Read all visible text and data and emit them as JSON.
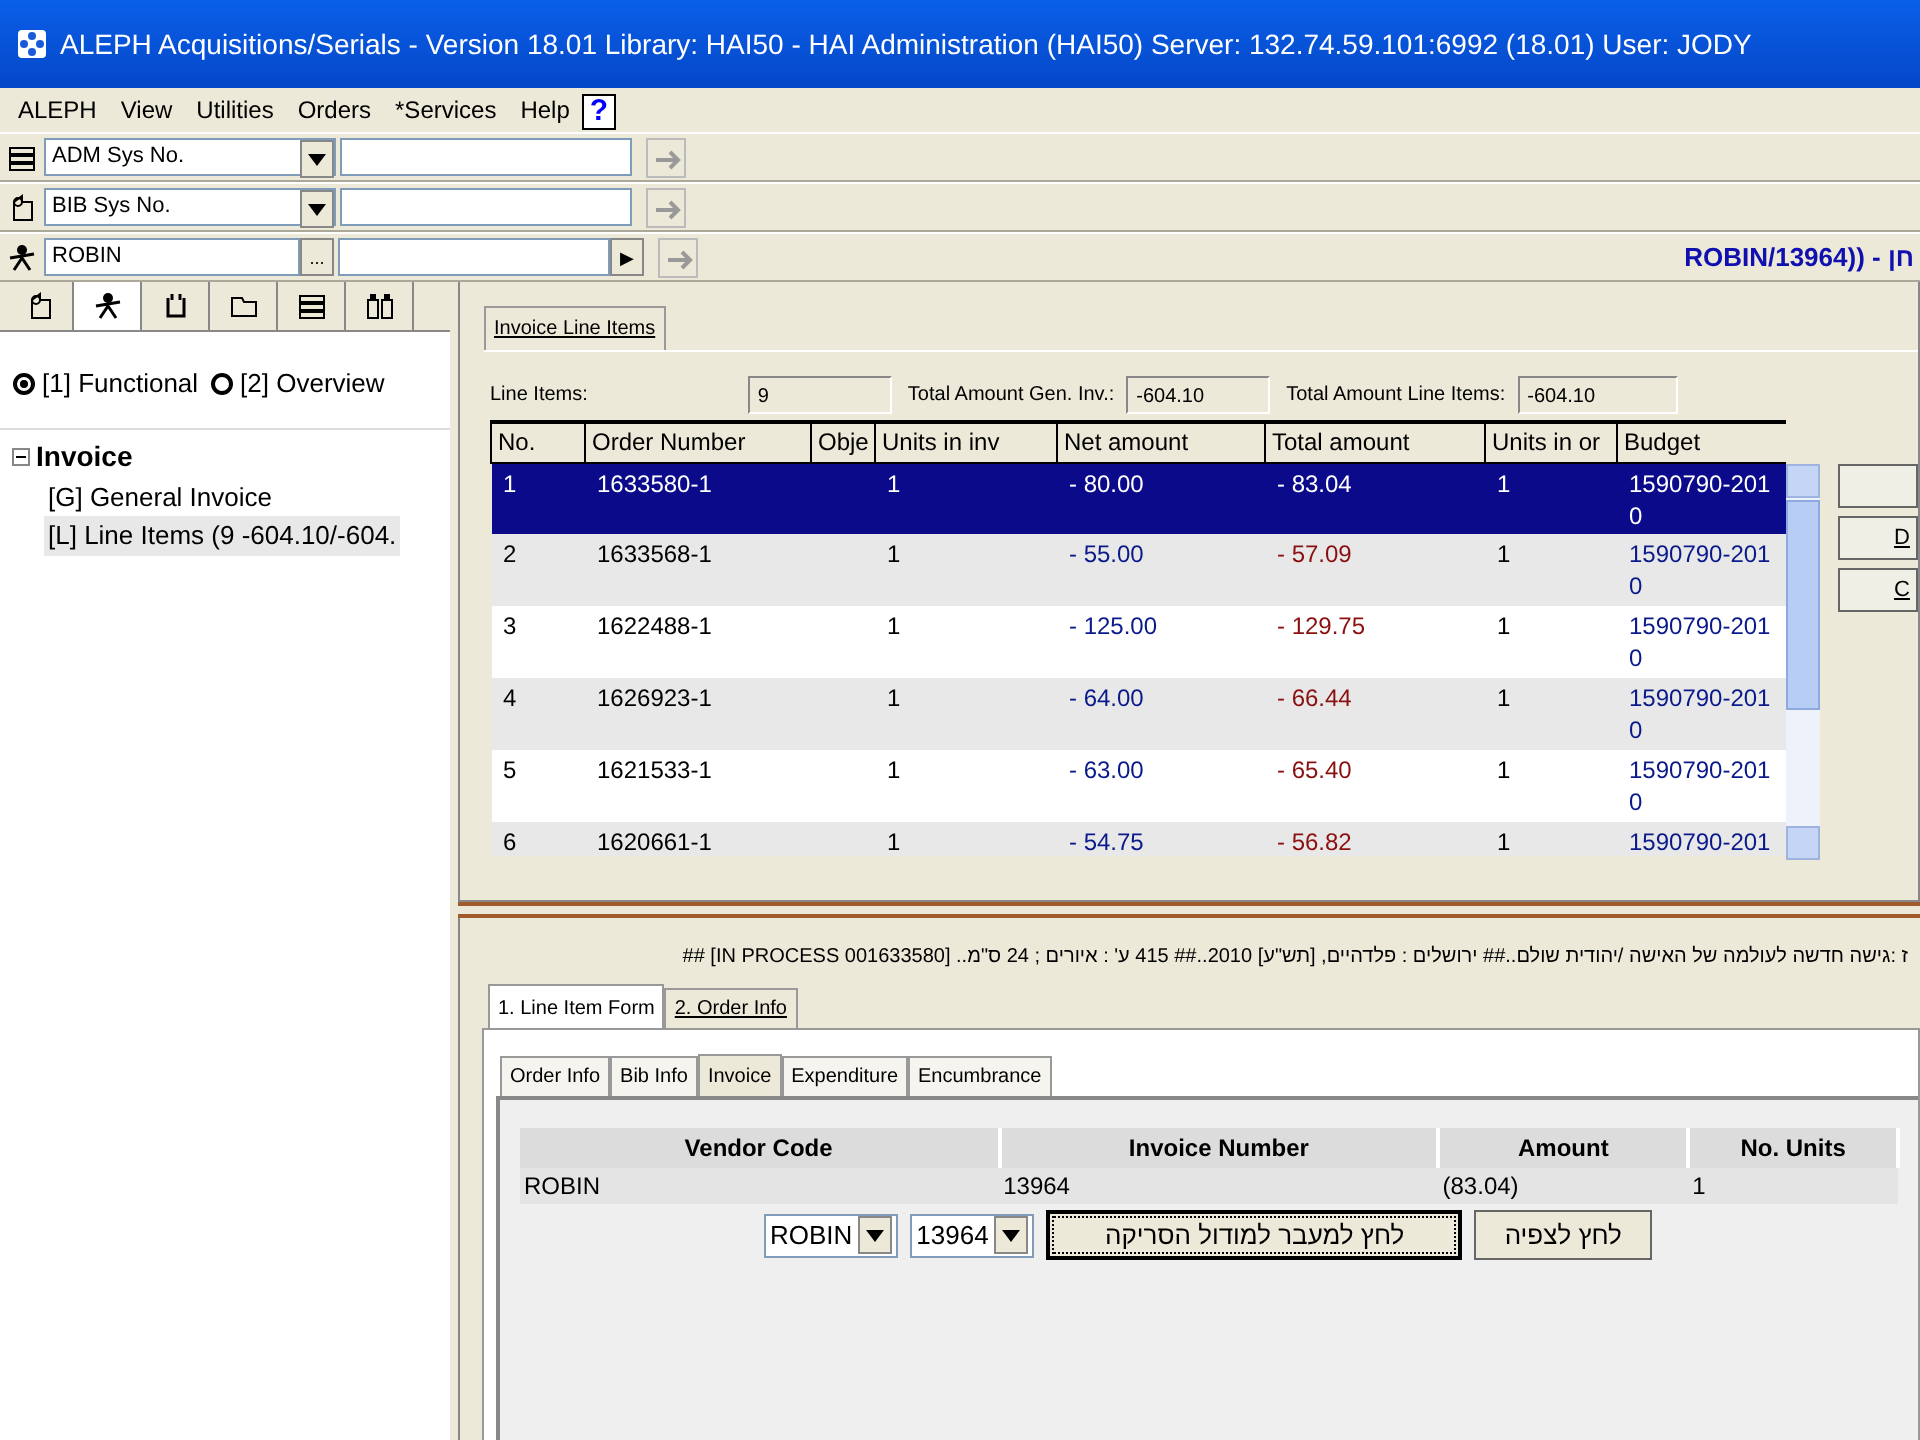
{
  "window": {
    "title": "ALEPH Acquisitions/Serials - Version 18.01  Library:  HAI50 - HAI Administration (HAI50)  Server:  132.74.59.101:6992 (18.01)  User:  JODY"
  },
  "menu": [
    "ALEPH",
    "View",
    "Utilities",
    "Orders",
    "*Services",
    "Help"
  ],
  "help_key": "?",
  "search_rows": [
    {
      "kind": "dropdown",
      "value": "ADM Sys No."
    },
    {
      "kind": "dropdown",
      "value": "BIB Sys No."
    },
    {
      "kind": "browse",
      "value": "ROBIN",
      "browse_key": "...",
      "play_key": "▶"
    }
  ],
  "record_header": "ROBIN/13964)) - חן",
  "left_tabs": [
    {
      "selected": false
    },
    {
      "selected": true
    },
    {
      "selected": false
    },
    {
      "selected": false
    },
    {
      "selected": false
    },
    {
      "selected": false
    }
  ],
  "view_options": [
    {
      "label": "[1] Functional",
      "selected": true
    },
    {
      "label": "[2] Overview",
      "selected": false
    }
  ],
  "tree": [
    {
      "label": "Invoice",
      "expanded": true,
      "children": [
        {
          "label": "[G] General Invoice",
          "selected": false
        },
        {
          "label": "[L] Line Items (9 -604.10/-604.",
          "selected": true
        }
      ]
    }
  ],
  "line_items": {
    "tab": "Invoice Line Items",
    "fields": [
      {
        "label": "Line Items:",
        "value": "9"
      },
      {
        "label": "Total Amount Gen. Inv.:",
        "value": "-604.10"
      },
      {
        "label": "Total Amount Line Items:",
        "value": "-604.10"
      }
    ],
    "columns": [
      "No.",
      "Order Number",
      "Obje",
      "Units in inv",
      "Net amount",
      "Total amount",
      "Units in or",
      "Budget"
    ],
    "rows": [
      {
        "selected": true,
        "cells": [
          "1",
          "1633580-1",
          "",
          "1",
          "- 80.00",
          "- 83.04",
          "1",
          "1590790-2010"
        ]
      },
      {
        "selected": false,
        "cells": [
          "2",
          "1633568-1",
          "",
          "1",
          "- 55.00",
          "- 57.09",
          "1",
          "1590790-2010"
        ]
      },
      {
        "selected": false,
        "cells": [
          "3",
          "1622488-1",
          "",
          "1",
          "- 125.00",
          "- 129.75",
          "1",
          "1590790-2010"
        ]
      },
      {
        "selected": false,
        "cells": [
          "4",
          "1626923-1",
          "",
          "1",
          "- 64.00",
          "- 66.44",
          "1",
          "1590790-2010"
        ]
      },
      {
        "selected": false,
        "cells": [
          "5",
          "1621533-1",
          "",
          "1",
          "- 63.00",
          "- 65.40",
          "1",
          "1590790-2010"
        ]
      },
      {
        "selected": false,
        "cells": [
          "6",
          "1620661-1",
          "",
          "1",
          "- 54.75",
          "- 56.82",
          "1",
          "1590790-201"
        ]
      }
    ]
  },
  "side_buttons": [
    {
      "kind": "blank"
    },
    {
      "kind": "labeled",
      "label": "D"
    },
    {
      "kind": "labeled",
      "label": "C"
    }
  ],
  "bib_line": "ז :גישה חדשה לעולמה של האישה /יהודית שולם..##  ירושלים : פלדהיים, [תש\"ע] 2010..##   415 ע' : איורים ; 24 ס\"מ.. [IN PROCESS 001633580] ##",
  "form_tabs": [
    {
      "label": "1. Line Item Form",
      "selected": true
    },
    {
      "label": "2. Order Info",
      "selected": false
    }
  ],
  "sub_tabs": [
    {
      "label": "Order Info",
      "selected": false
    },
    {
      "label": "Bib Info",
      "selected": false
    },
    {
      "label": "Invoice",
      "selected": true
    },
    {
      "label": "Expenditure",
      "selected": false
    },
    {
      "label": "Encumbrance",
      "selected": false
    }
  ],
  "invoice_table": {
    "columns": [
      "Vendor Code",
      "Invoice Number",
      "Amount",
      "No. Units"
    ],
    "rows": [
      [
        "ROBIN",
        "13964",
        "(83.04)",
        "1"
      ]
    ]
  },
  "vendor_select": "ROBIN",
  "invoice_select": "13964",
  "buttons": [
    {
      "label": "לחץ לצפיה",
      "focused": false
    },
    {
      "label": "לחץ למעבר למודול הסריקה",
      "focused": true
    }
  ]
}
